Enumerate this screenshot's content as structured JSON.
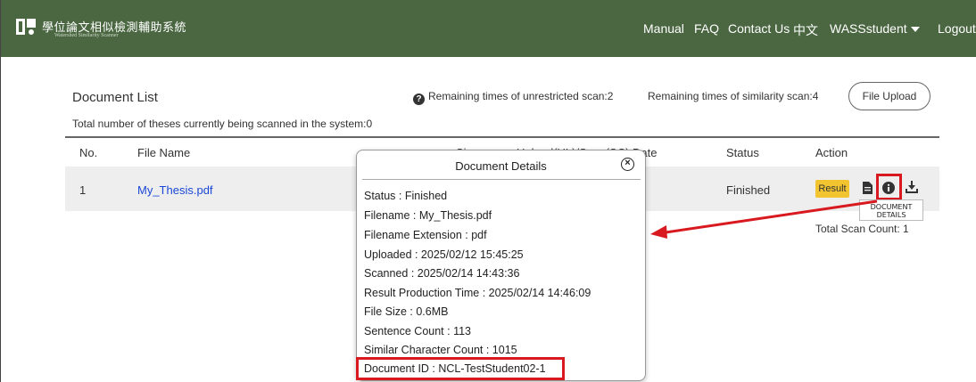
{
  "header": {
    "logo_title": "學位論文相似檢測輔助系統",
    "logo_subtitle": "Watershed Similarity Scanner",
    "nav": {
      "manual": "Manual",
      "faq": "FAQ",
      "contact": "Contact Us",
      "language": "中文",
      "user": "WASSstudent",
      "logout": "Logout"
    }
  },
  "list": {
    "title": "Document List",
    "remaining_unrestricted": "Remaining times of unrestricted scan:2",
    "remaining_similarity": "Remaining times of similarity scan:4",
    "upload_label": "File Upload",
    "system_info": "Total number of theses currently being scanned in the system:0",
    "columns": [
      "No.",
      "File Name",
      "Size",
      "Upload(UL)/Scan(SC) Date",
      "Status",
      "Action"
    ],
    "rows": [
      {
        "no": "1",
        "file_name": "My_Thesis.pdf",
        "status": "Finished",
        "result_label": "Result"
      }
    ],
    "tooltip": "DOCUMENT DETAILS",
    "total_scan": "Total Scan Count: 1"
  },
  "popup": {
    "title": "Document Details",
    "details": [
      "Status : Finished",
      "Filename : My_Thesis.pdf",
      "Filename Extension : pdf",
      "Uploaded : 2025/02/12 15:45:25",
      "Scanned : 2025/02/14 14:43:36",
      "Result Production Time : 2025/02/14 14:46:09",
      "File Size : 0.6MB",
      "Sentence Count : 113",
      "Similar Character Count : 1015",
      "Document ID : NCL-TestStudent02-1"
    ]
  },
  "colors": {
    "header_bg": "#4a6741",
    "link": "#1a48d6",
    "result_button": "#f2c430",
    "highlight": "#d8191f"
  }
}
